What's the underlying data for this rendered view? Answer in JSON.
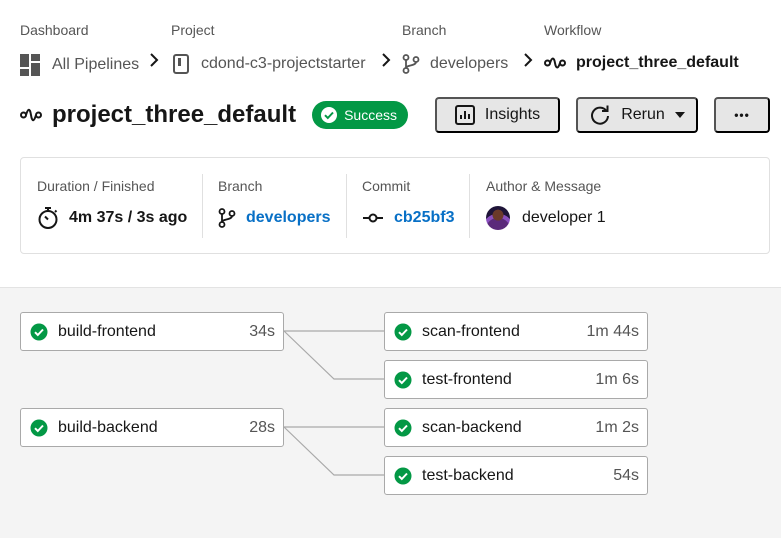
{
  "breadcrumbs": {
    "dashboard": {
      "label": "Dashboard",
      "value": "All Pipelines"
    },
    "project": {
      "label": "Project",
      "value": "cdond-c3-projectstarter"
    },
    "branch": {
      "label": "Branch",
      "value": "developers"
    },
    "workflow": {
      "label": "Workflow",
      "value": "project_three_default"
    }
  },
  "header": {
    "title": "project_three_default",
    "status": "Success",
    "insights_label": "Insights",
    "rerun_label": "Rerun",
    "more_label": "•••"
  },
  "summary": {
    "duration": {
      "label": "Duration / Finished",
      "value": "4m 37s / 3s ago"
    },
    "branch": {
      "label": "Branch",
      "value": "developers"
    },
    "commit": {
      "label": "Commit",
      "value": "cb25bf3"
    },
    "author": {
      "label": "Author & Message",
      "value": "developer 1"
    }
  },
  "jobs": [
    {
      "name": "build-frontend",
      "duration": "34s",
      "status": "success"
    },
    {
      "name": "scan-frontend",
      "duration": "1m 44s",
      "status": "success"
    },
    {
      "name": "test-frontend",
      "duration": "1m 6s",
      "status": "success"
    },
    {
      "name": "build-backend",
      "duration": "28s",
      "status": "success"
    },
    {
      "name": "scan-backend",
      "duration": "1m 2s",
      "status": "success"
    },
    {
      "name": "test-backend",
      "duration": "54s",
      "status": "success"
    }
  ],
  "colors": {
    "success": "#039845",
    "link": "#0870c6",
    "button_bg": "#e6e6e6",
    "graph_bg": "#f4f4f4"
  },
  "icons": [
    "dashboard-grid-icon",
    "project-icon",
    "branch-icon",
    "workflow-icon",
    "chevron-right-icon",
    "check-circle-icon",
    "insights-icon",
    "rerun-icon",
    "caret-down-icon",
    "more-icon",
    "stopwatch-icon",
    "commit-icon",
    "avatar"
  ]
}
